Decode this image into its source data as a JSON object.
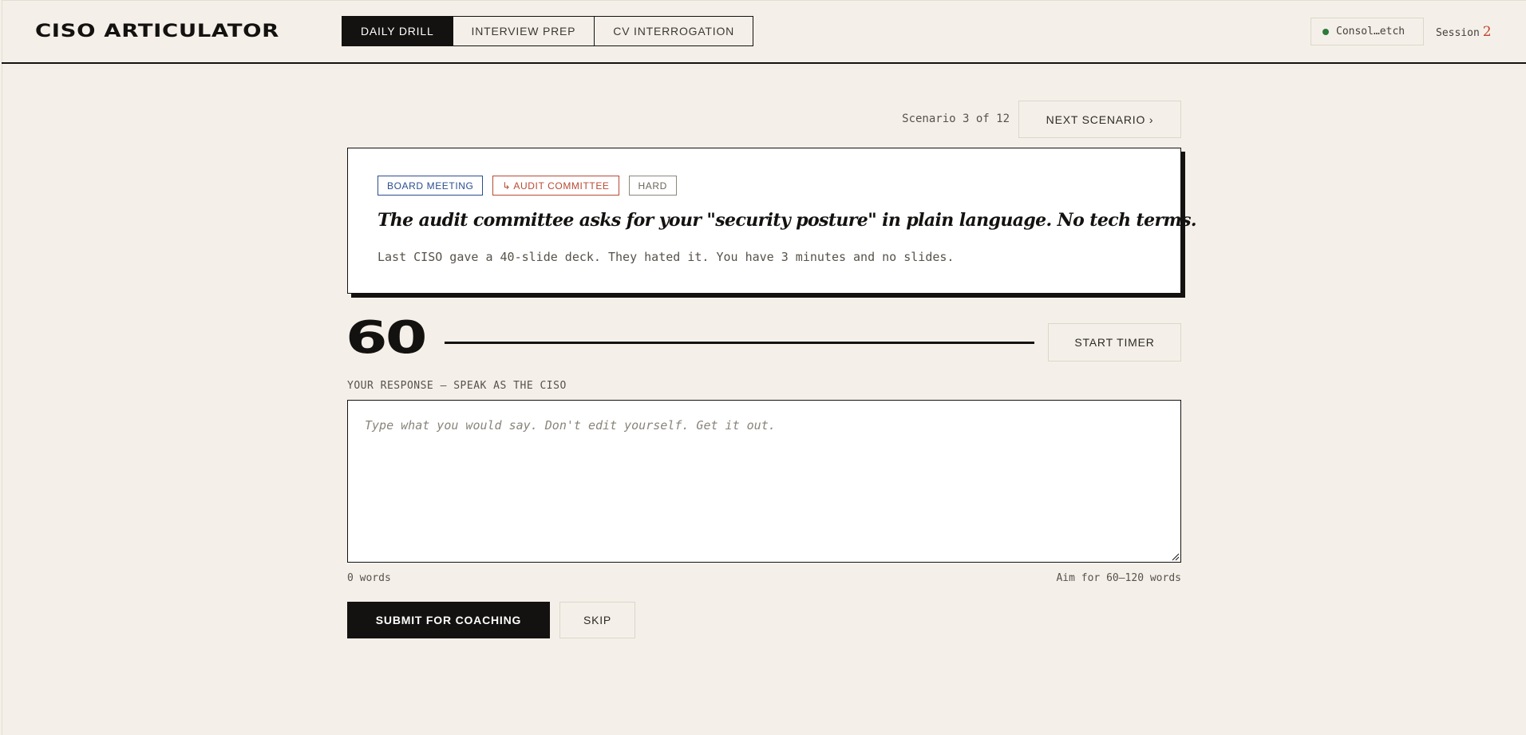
{
  "app": {
    "title": "CISO ARTICULATOR"
  },
  "nav": {
    "tabs": [
      {
        "label": "DAILY DRILL",
        "active": true
      },
      {
        "label": "INTERVIEW PREP",
        "active": false
      },
      {
        "label": "CV INTERROGATION",
        "active": false
      }
    ]
  },
  "status": {
    "model": "Consol…etch",
    "color": "#2d7a3a",
    "session_label": "Session",
    "session_number": "2"
  },
  "scenario": {
    "counter": "Scenario 3 of 12",
    "next_label": "NEXT SCENARIO ›",
    "tags": [
      "BOARD MEETING",
      "↳ AUDIT COMMITTEE",
      "HARD"
    ],
    "prompt": "The audit committee asks for your \"security posture\" in plain language. No tech terms.",
    "context": "Last CISO gave a 40-slide deck. They hated it. You have 3 minutes and no slides."
  },
  "timer": {
    "seconds": "60",
    "start_label": "START TIMER"
  },
  "response": {
    "label": "YOUR RESPONSE — SPEAK AS THE CISO",
    "placeholder": "Type what you would say. Don't edit yourself. Get it out.",
    "value": "",
    "word_count": "0 words",
    "target": "Aim for 60–120 words"
  },
  "actions": {
    "submit_label": "SUBMIT FOR COACHING",
    "skip_label": "SKIP"
  },
  "colors": {
    "background": "#f4f0e9",
    "ink": "#141210",
    "tag_blue": "#2b4d8f",
    "tag_red": "#b84a33",
    "accent_red": "#c0442c"
  }
}
